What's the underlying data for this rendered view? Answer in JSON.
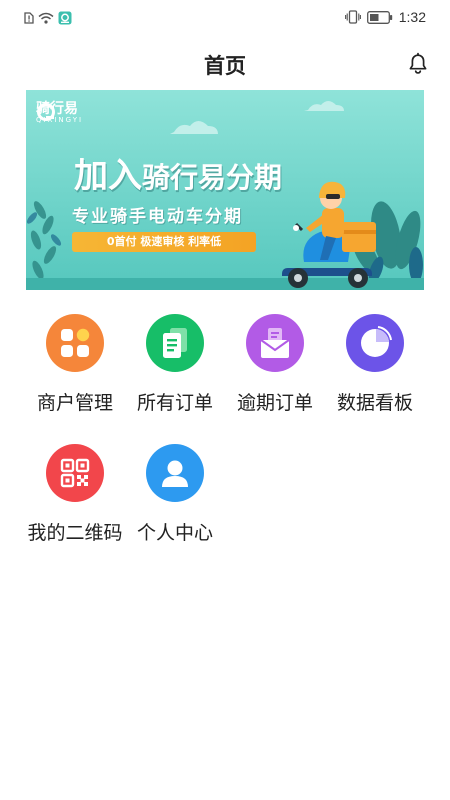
{
  "status_bar": {
    "time": "1:32",
    "icons": [
      "alert-sim-icon",
      "wifi-icon",
      "app-notification-icon",
      "vibrate-icon",
      "battery-icon"
    ]
  },
  "header": {
    "title": "首页",
    "right_icon": "bell-icon"
  },
  "banner": {
    "brand_name": "骑行易",
    "brand_pinyin": "QIXINGYI",
    "headline_a": "加入",
    "headline_b": "骑行易分期",
    "subline": "专业骑手电动车分期",
    "tagline": "0首付   极速审核   利率低"
  },
  "menu": {
    "items": [
      {
        "label": "商户管理",
        "icon": "merchant-grid-icon",
        "color": "#f5863a"
      },
      {
        "label": "所有订单",
        "icon": "orders-document-icon",
        "color": "#17be68"
      },
      {
        "label": "逾期订单",
        "icon": "overdue-envelope-icon",
        "color": "#b25be6"
      },
      {
        "label": "数据看板",
        "icon": "data-pie-chart-icon",
        "color": "#6c54e8"
      },
      {
        "label": "我的二维码",
        "icon": "qr-code-icon",
        "color": "#f2464b"
      },
      {
        "label": "个人中心",
        "icon": "user-profile-icon",
        "color": "#2d9af0"
      }
    ]
  }
}
